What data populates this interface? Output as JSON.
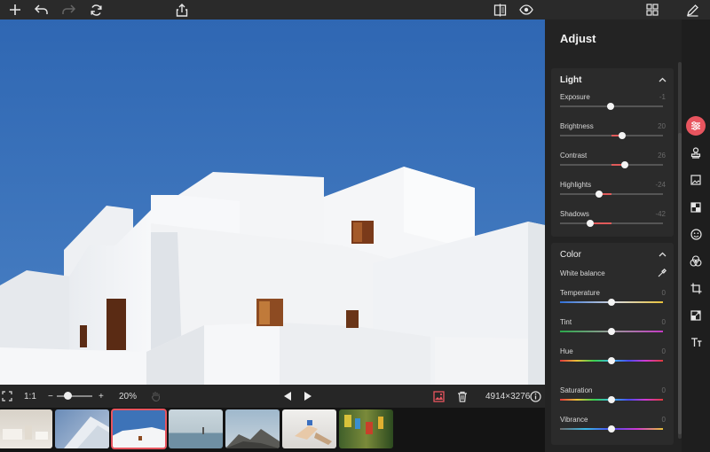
{
  "toolbar": {
    "icons": [
      "plus-icon",
      "undo-icon",
      "redo-icon",
      "refresh-icon",
      "share-icon",
      "compare-icon",
      "eye-icon",
      "grid-icon",
      "edit-icon"
    ]
  },
  "controls": {
    "fit_label": "1:1",
    "zoom_minus": "−",
    "zoom_plus": "+",
    "zoom_value": "20%",
    "zoom_level": 0.3,
    "dimensions": "4914×3276"
  },
  "panel": {
    "title": "Adjust",
    "light": {
      "heading": "Light",
      "sliders": [
        {
          "label": "Exposure",
          "value": "-1",
          "level": 0.49
        },
        {
          "label": "Brightness",
          "value": "20",
          "level": 0.6
        },
        {
          "label": "Contrast",
          "value": "26",
          "level": 0.63
        },
        {
          "label": "Highlights",
          "value": "-24",
          "level": 0.38
        },
        {
          "label": "Shadows",
          "value": "-42",
          "level": 0.29
        }
      ]
    },
    "color": {
      "heading": "Color",
      "white_balance_label": "White balance",
      "sliders": [
        {
          "label": "Temperature",
          "value": "0",
          "level": 0.5
        },
        {
          "label": "Tint",
          "value": "0",
          "level": 0.5
        },
        {
          "label": "Hue",
          "value": "0",
          "level": 0.5
        },
        {
          "label": "Saturation",
          "value": "0",
          "level": 0.5
        },
        {
          "label": "Vibrance",
          "value": "0",
          "level": 0.5
        }
      ]
    }
  },
  "tools": [
    "adjust-icon",
    "stamp-icon",
    "image-icon",
    "checker-icon",
    "face-icon",
    "blend-icon",
    "crop-icon",
    "resize-icon",
    "text-icon"
  ],
  "colors": {
    "accent": "#e8555f",
    "sky": "#3d73b8"
  }
}
